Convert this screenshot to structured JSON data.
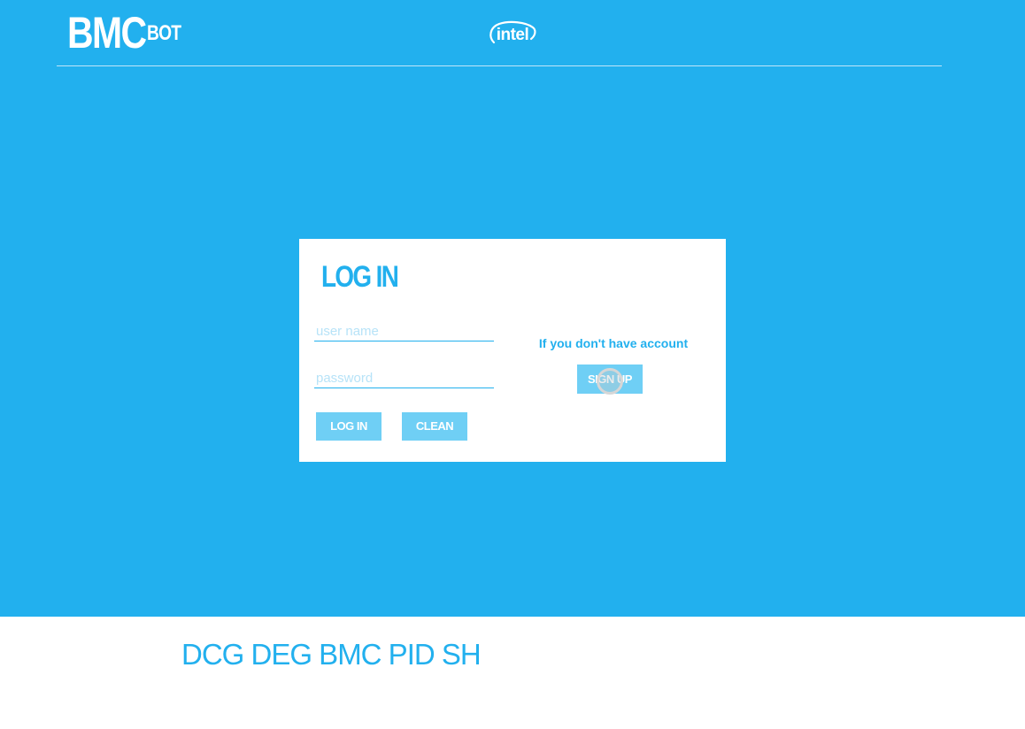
{
  "header": {
    "logo_main": "BMC",
    "logo_sub": "BOT",
    "brand": "intel"
  },
  "login": {
    "title": "LOG IN",
    "username_placeholder": "user name",
    "password_placeholder": "password",
    "login_button": "LOG IN",
    "clean_button": "CLEAN",
    "register_prompt": "If you don't have account",
    "register_button": "SIGN UP"
  },
  "footer": {
    "text": "DCG DEG BMC PID SH"
  },
  "colors": {
    "primary": "#22b0ee",
    "button": "#6fcff5",
    "card": "#ffffff"
  },
  "icons": {
    "cursor": "click-cursor-icon"
  }
}
